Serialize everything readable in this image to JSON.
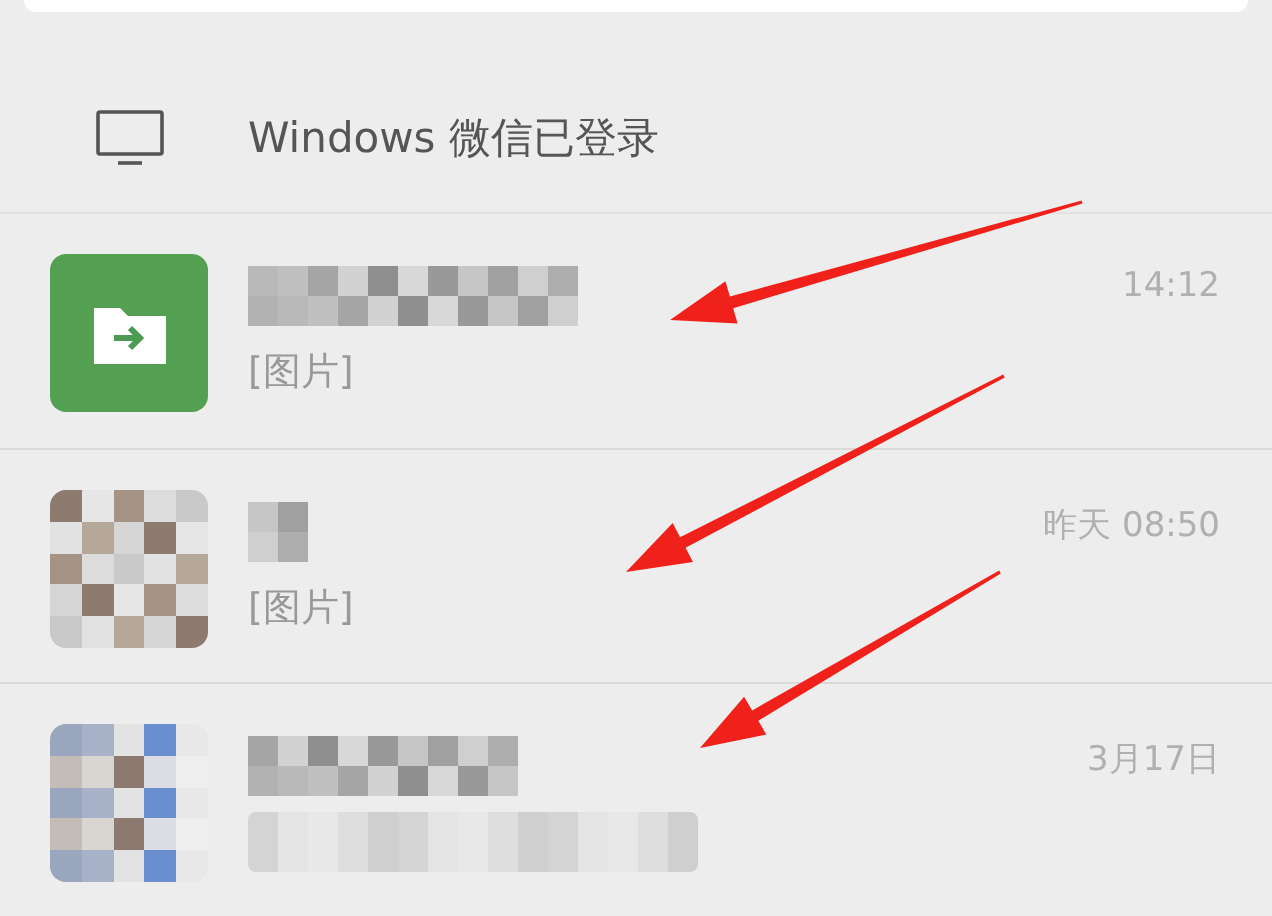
{
  "search_bar": {
    "kind": "field"
  },
  "login_banner": {
    "text": "Windows 微信已登录"
  },
  "chats": [
    {
      "avatar": {
        "kind": "file-transfer"
      },
      "name_redacted": true,
      "message": "[图片]",
      "time": "14:12"
    },
    {
      "avatar": {
        "kind": "mosaic"
      },
      "name_redacted": true,
      "message": "[图片]",
      "time": "昨天 08:50"
    },
    {
      "avatar": {
        "kind": "mosaic"
      },
      "name_redacted": true,
      "message_redacted": true,
      "time": "3月17日"
    }
  ],
  "annotations": [
    {
      "kind": "arrow"
    },
    {
      "kind": "arrow"
    },
    {
      "kind": "arrow"
    }
  ]
}
